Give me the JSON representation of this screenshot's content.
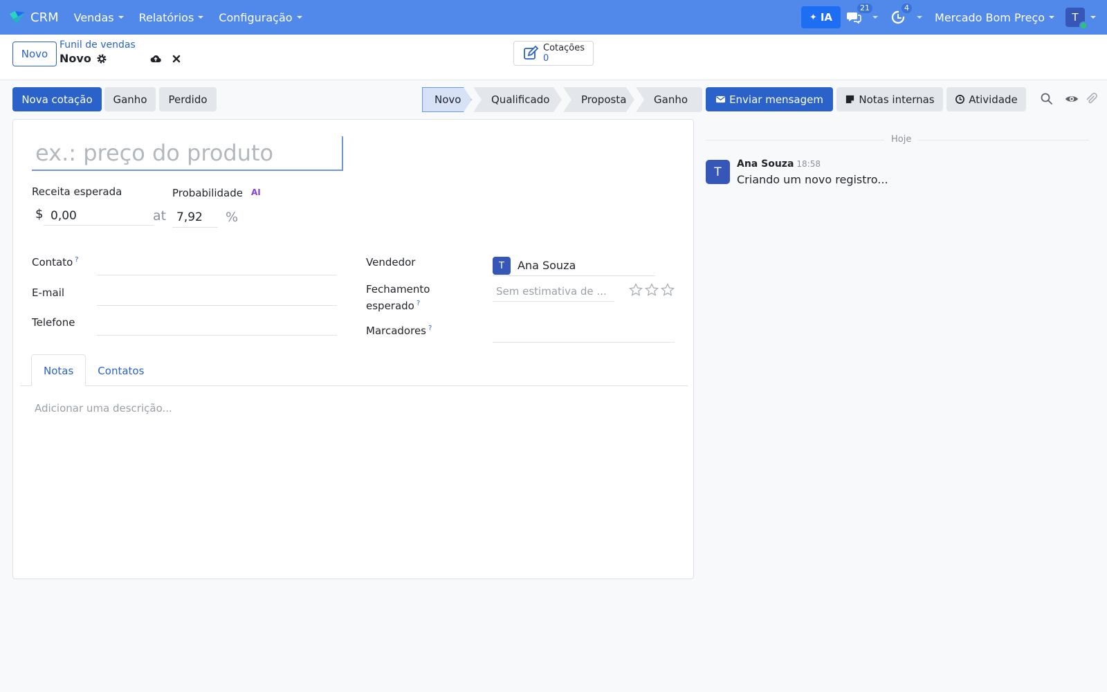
{
  "navbar": {
    "brand": "CRM",
    "menus": [
      "Vendas",
      "Relatórios",
      "Configuração"
    ],
    "ai_label": "IA",
    "messages_count": "21",
    "activities_count": "4",
    "company": "Mercado Bom Preço",
    "user_initial": "T",
    "color": "#5089ea"
  },
  "control": {
    "new_label": "Novo",
    "breadcrumb": "Funil de vendas",
    "record_name": "Novo",
    "smart_button": {
      "label": "Cotações",
      "count": "0"
    }
  },
  "statusbar": {
    "buttons": [
      "Nova cotação",
      "Ganho",
      "Perdido"
    ],
    "stages": [
      "Novo",
      "Qualificado",
      "Proposta",
      "Ganho"
    ],
    "active_stage": "Novo"
  },
  "form": {
    "name_placeholder": "ex.: preço do produto",
    "expected_revenue_label": "Receita esperada",
    "probability_label": "Probabilidade",
    "ai_badge": "AI",
    "currency": "$",
    "revenue_value": "0,00",
    "at_label": "at",
    "probability_value": "7,92",
    "percent": "%",
    "contact_label": "Contato",
    "email_label": "E-mail",
    "phone_label": "Telefone",
    "salesperson_label": "Vendedor",
    "salesperson_initial": "T",
    "salesperson_name": "Ana Souza",
    "closing_label_1": "Fechamento",
    "closing_label_2": "esperado",
    "closing_placeholder": "Sem estimativa de ...",
    "tags_label": "Marcadores",
    "help": "?",
    "priority_stars": 0,
    "tabs": [
      "Notas",
      "Contatos"
    ],
    "description_placeholder": "Adicionar uma descrição..."
  },
  "chatter": {
    "send_message": "Enviar mensagem",
    "internal_notes": "Notas internas",
    "activity": "Atividade",
    "day_label": "Hoje",
    "message": {
      "initial": "T",
      "author": "Ana Souza",
      "time": "18:58",
      "body": "Criando um novo registro..."
    }
  }
}
